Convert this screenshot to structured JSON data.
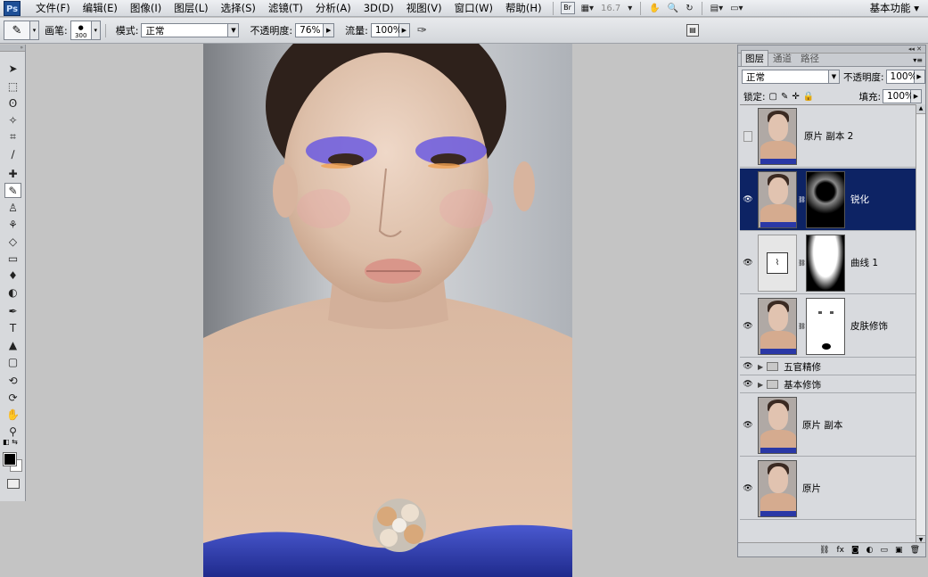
{
  "app": {
    "logo": "Ps"
  },
  "menubar": {
    "items": [
      "文件(F)",
      "编辑(E)",
      "图像(I)",
      "图层(L)",
      "选择(S)",
      "滤镜(T)",
      "分析(A)",
      "3D(D)",
      "视图(V)",
      "窗口(W)",
      "帮助(H)"
    ],
    "bridge_label": "Br",
    "zoom": "16.7",
    "workspace": "基本功能"
  },
  "options": {
    "brush_label": "画笔:",
    "brush_size": "300",
    "mode_label": "模式:",
    "mode_value": "正常",
    "opacity_label": "不透明度:",
    "opacity_value": "76%",
    "flow_label": "流量:",
    "flow_value": "100%"
  },
  "layers_panel": {
    "tabs": [
      "图层",
      "通道",
      "路径"
    ],
    "blend_mode": "正常",
    "opacity_label": "不透明度:",
    "opacity_value": "100%",
    "lock_label": "锁定:",
    "fill_label": "填充:",
    "fill_value": "100%",
    "layers": [
      {
        "name": "原片 副本 2",
        "visible": false
      },
      {
        "name": "锐化",
        "visible": true,
        "selected": true
      },
      {
        "name": "曲线 1",
        "visible": true
      },
      {
        "name": "皮肤修饰",
        "visible": true
      },
      {
        "name": "五官精修",
        "visible": true,
        "group": true
      },
      {
        "name": "基本修饰",
        "visible": true,
        "group": true
      },
      {
        "name": "原片 副本",
        "visible": true
      },
      {
        "name": "原片",
        "visible": true
      }
    ]
  },
  "colors": {
    "selection": "#0d2364",
    "dress": "#2c39a8",
    "eyeshadow": "#6b5be0"
  }
}
